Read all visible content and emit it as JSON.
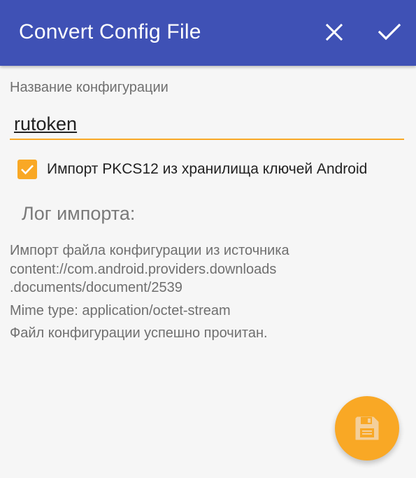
{
  "colors": {
    "toolbar": "#3f51b5",
    "accent": "#f9a825",
    "background": "#f6f6f6",
    "secondary_text": "#6f6f6f"
  },
  "toolbar": {
    "title": "Convert Config File",
    "close_icon": "close-icon",
    "confirm_icon": "check-icon"
  },
  "form": {
    "name_label": "Название конфигурации",
    "name_value": "rutoken",
    "pkcs12_checked": true,
    "pkcs12_label": "Импорт PKCS12 из хранилища ключей Android"
  },
  "log": {
    "title": "Лог импорта:",
    "lines": [
      "Импорт файла конфигурации из источника",
      "content://com.android.providers.downloads",
      ".documents/document/2539",
      "Mime type: application/octet-stream",
      "Файл конфигурации успешно прочитан."
    ]
  },
  "fab": {
    "icon": "save-icon"
  }
}
